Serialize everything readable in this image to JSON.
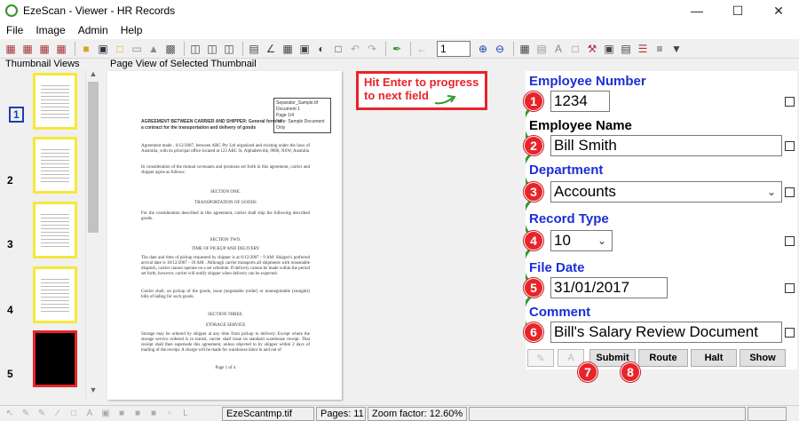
{
  "window": {
    "title": "EzeScan - Viewer - HR Records"
  },
  "menu": [
    "File",
    "Image",
    "Admin",
    "Help"
  ],
  "toolbar": {
    "page_input": "1"
  },
  "panels": {
    "thumbnails_header": "Thumbnail Views",
    "page_view_header": "Page View of Selected Thumbnail"
  },
  "thumbnails": [
    {
      "num": "1",
      "selected": true
    },
    {
      "num": "2"
    },
    {
      "num": "3"
    },
    {
      "num": "4"
    },
    {
      "num": "5"
    }
  ],
  "document": {
    "box": [
      "Separator_Sample.tif",
      "Document 1",
      "Page 1/4",
      "Note: Sample Document Only"
    ],
    "heading": "AGREEMENT BETWEEN CARRIER AND SHIPPER: General form of a contract for the transportation and delivery of goods",
    "para1": "Agreement made , 6/12/2007, between ABC Pty Ltd organized and existing under the laws of Australia, with its principal office located at 123 ABC St, Alphabetville, 9000, NSW, Australia",
    "para2": "In consideration of the mutual covenants and promises set forth in this agreement, carrier and shipper agree as follows:",
    "s1": "SECTION ONE.",
    "s1t": "TRANSPORTATION OF GOODS",
    "para3": "For the consideration described in this agreement, carrier shall ship the following described goods.",
    "s2": "SECTION TWO.",
    "s2t": "TIME OF PICKUP AND DELIVERY",
    "para4": "The date and time of pickup requested by shipper is at 6/12/2007 - 9 AM. Shipper's preferred arrival date is 10/12/2007 - 10 AM . Although carrier transports all shipments with reasonable dispatch, carrier cannot operate on a set schedule. If delivery cannot be made within the period set forth, however, carrier will notify shipper when delivery can be expected.",
    "para5": "Carrier shall, on pickup of the goods, issue (negotiable (order) or nonnegotiable (straight)) bills of lading for such goods.",
    "s3": "SECTION THREE.",
    "s3t": "STORAGE SERVICE",
    "para6": "Storage may be ordered by shipper at any time from pickup to delivery. Except where the storage service ordered is in transit, carrier shall issue its standard warehouse receipt. That receipt shall then supersede this agreement, unless objected to by shipper within 2 days of mailing of the receipt. A charge will be made for warehouse labor in and out of",
    "footer": "Page 1 of 4"
  },
  "callout": {
    "line1": "Hit Enter to progress",
    "line2": "to next field"
  },
  "form": {
    "employee_number": {
      "label": "Employee Number",
      "value": "1234"
    },
    "employee_name": {
      "label": "Employee Name",
      "value": "Bill Smith"
    },
    "department": {
      "label": "Department",
      "value": "Accounts"
    },
    "record_type": {
      "label": "Record Type",
      "value": "10"
    },
    "file_date": {
      "label": "File Date",
      "value": "31/01/2017"
    },
    "comment": {
      "label": "Comment",
      "value": "Bill's Salary Review Document"
    }
  },
  "steps": [
    "1",
    "2",
    "3",
    "4",
    "5",
    "6",
    "7",
    "8"
  ],
  "buttons": {
    "submit": "Submit",
    "route": "Route",
    "halt": "Halt",
    "show": "Show"
  },
  "status": {
    "filename": "EzeScantmp.tif",
    "pages": "Pages: 11",
    "zoom": "Zoom factor: 12.60%"
  },
  "colors": {
    "accent_red": "#e8242a",
    "label_blue": "#1b2fd6",
    "thumb_border": "#f5e83a",
    "flow_green": "#2e9a2e"
  }
}
